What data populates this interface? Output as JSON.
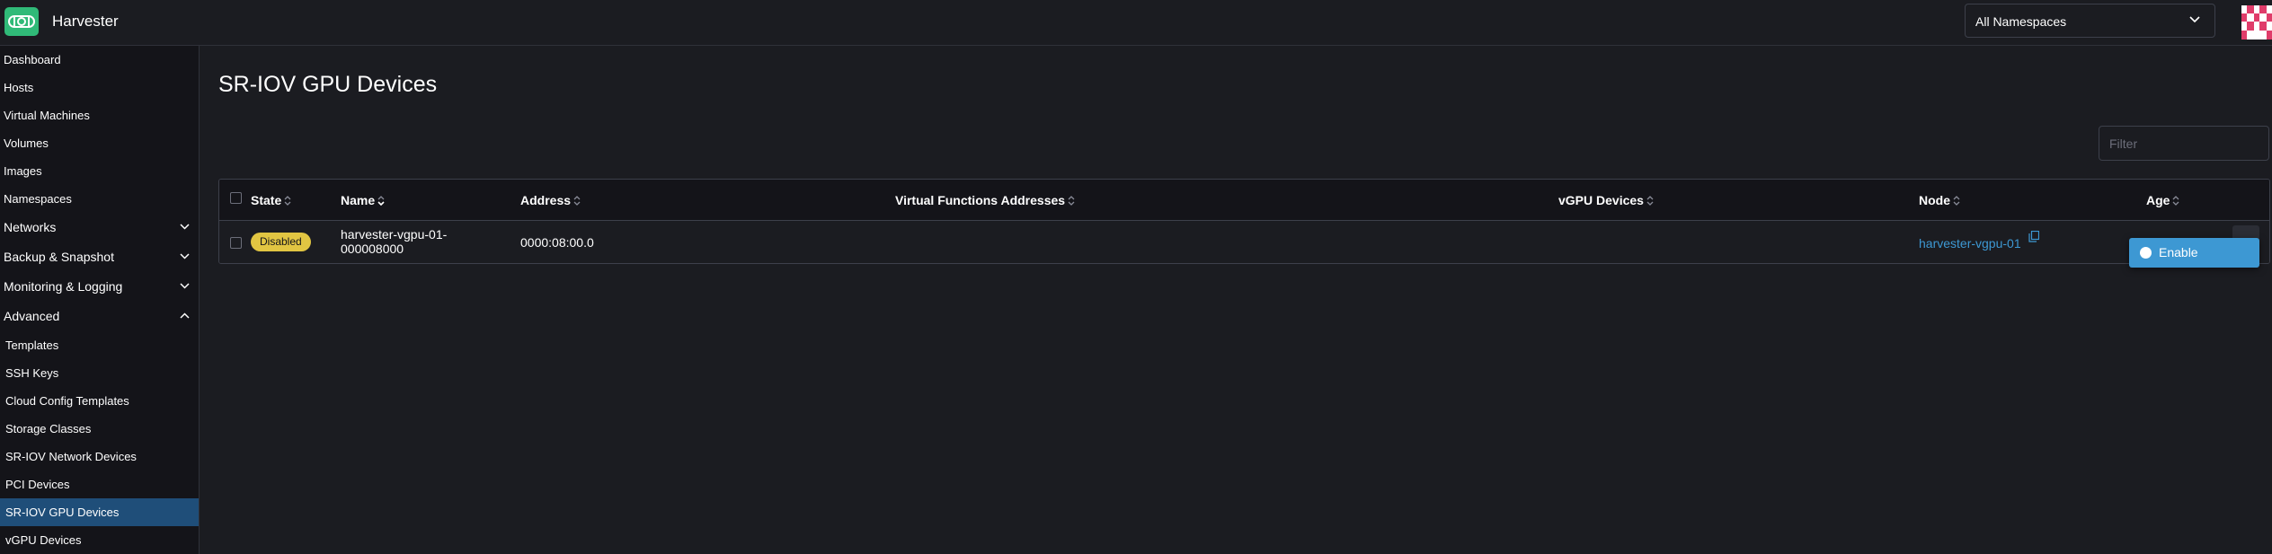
{
  "header": {
    "app_name": "Harvester",
    "namespace_selector": {
      "value": "All Namespaces"
    }
  },
  "sidebar": {
    "items": [
      {
        "label": "Dashboard"
      },
      {
        "label": "Hosts"
      },
      {
        "label": "Virtual Machines"
      },
      {
        "label": "Volumes"
      },
      {
        "label": "Images"
      },
      {
        "label": "Namespaces"
      }
    ],
    "groups": [
      {
        "label": "Networks",
        "expanded": false
      },
      {
        "label": "Backup & Snapshot",
        "expanded": false
      },
      {
        "label": "Monitoring & Logging",
        "expanded": false
      },
      {
        "label": "Advanced",
        "expanded": true
      }
    ],
    "advanced_items": [
      {
        "label": "Templates"
      },
      {
        "label": "SSH Keys"
      },
      {
        "label": "Cloud Config Templates"
      },
      {
        "label": "Storage Classes"
      },
      {
        "label": "SR-IOV Network Devices"
      },
      {
        "label": "PCI Devices"
      },
      {
        "label": "SR-IOV GPU Devices",
        "active": true
      },
      {
        "label": "vGPU Devices"
      }
    ]
  },
  "main": {
    "title": "SR-IOV GPU Devices",
    "filter_placeholder": "Filter",
    "table": {
      "columns": [
        "State",
        "Name",
        "Address",
        "Virtual Functions Addresses",
        "vGPU Devices",
        "Node",
        "Age"
      ],
      "rows": [
        {
          "state": "Disabled",
          "name_line1": "harvester-vgpu-01-",
          "name_line2": "000008000",
          "address": "0000:08:00.0",
          "virtual_functions_addresses": "",
          "vgpu_devices": "",
          "node": "harvester-vgpu-01"
        }
      ]
    },
    "action_menu": {
      "items": [
        {
          "label": "Enable"
        }
      ]
    }
  },
  "colors": {
    "accent": "#3d98d3",
    "brand_green": "#30ba78",
    "badge_disabled": "#e1c542",
    "active_nav": "#1f4e79"
  }
}
